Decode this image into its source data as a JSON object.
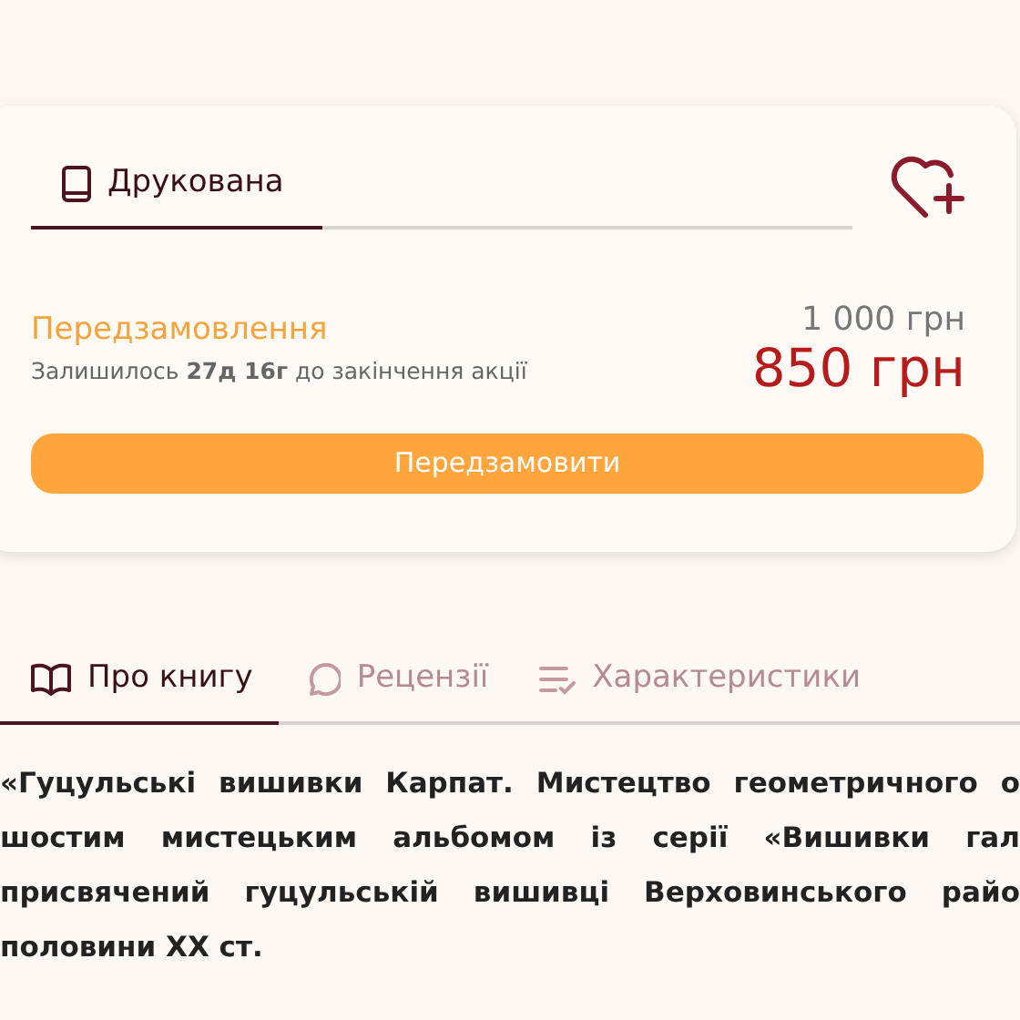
{
  "format_tabs": [
    {
      "label": "Друкована",
      "kind": "book",
      "selected": true
    }
  ],
  "preorder": {
    "title": "Передзамовлення",
    "countdown": "Залишилось **27д 16г** до закінчення акції"
  },
  "prices": {
    "old": "1 000 грн",
    "current": "850 грн"
  },
  "order_button": "Передзамовити",
  "info_tabs": [
    {
      "label": "Про книгу",
      "kind": "open-book",
      "selected": true
    },
    {
      "label": "Рецензії",
      "kind": "comment",
      "selected": false
    },
    {
      "label": "Характеристики",
      "kind": "list",
      "selected": false
    }
  ],
  "description": {
    "lines": [
      "«Гуцульські вишивки Карпат. Мистецтво геометричного о",
      "шостим мистецьким альбомом із серії «Вишивки гал",
      "присвячений гуцульській вишивці Верховинського райо",
      "половини XX ст."
    ]
  }
}
